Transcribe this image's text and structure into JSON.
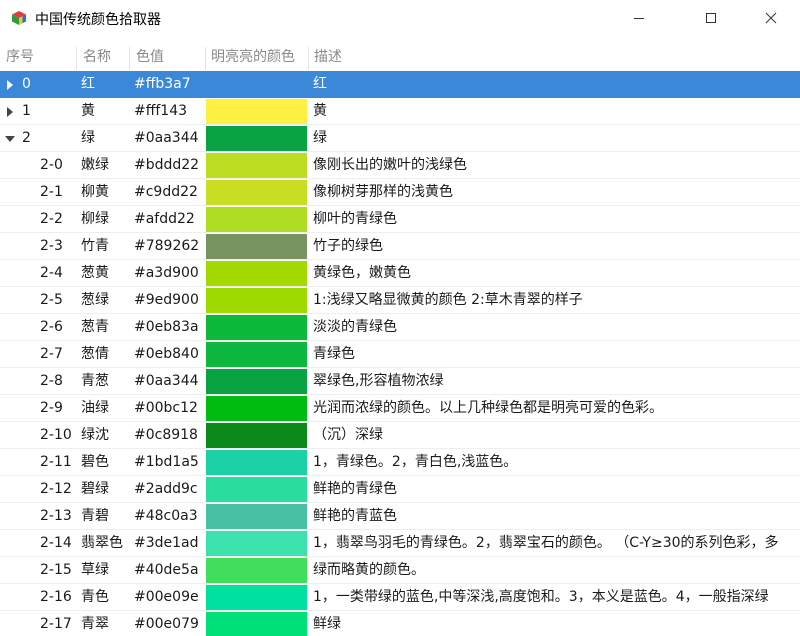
{
  "window": {
    "title": "中国传统颜色拾取器",
    "controls": [
      "minimize",
      "maximize",
      "close"
    ]
  },
  "columns": [
    "序号",
    "名称",
    "色值",
    "明亮亮的颜色",
    "描述"
  ],
  "rows": [
    {
      "id": "0",
      "name": "红",
      "hex": "#ffb3a7",
      "desc": "红",
      "level": 0,
      "toggle": "collapsed",
      "selected": true
    },
    {
      "id": "1",
      "name": "黄",
      "hex": "#fff143",
      "desc": "黄",
      "level": 0,
      "toggle": "collapsed"
    },
    {
      "id": "2",
      "name": "绿",
      "hex": "#0aa344",
      "desc": "绿",
      "level": 0,
      "toggle": "expanded"
    },
    {
      "id": "2-0",
      "name": "嫩绿",
      "hex": "#bddd22",
      "desc": "像刚长出的嫩叶的浅绿色",
      "level": 1
    },
    {
      "id": "2-1",
      "name": "柳黄",
      "hex": "#c9dd22",
      "desc": "像柳树芽那样的浅黄色",
      "level": 1
    },
    {
      "id": "2-2",
      "name": "柳绿",
      "hex": "#afdd22",
      "desc": "柳叶的青绿色",
      "level": 1
    },
    {
      "id": "2-3",
      "name": "竹青",
      "hex": "#789262",
      "desc": "竹子的绿色",
      "level": 1
    },
    {
      "id": "2-4",
      "name": "葱黄",
      "hex": "#a3d900",
      "desc": "黄绿色，嫩黄色",
      "level": 1
    },
    {
      "id": "2-5",
      "name": "葱绿",
      "hex": "#9ed900",
      "desc": "1:浅绿又略显微黄的颜色 2:草木青翠的样子",
      "level": 1
    },
    {
      "id": "2-6",
      "name": "葱青",
      "hex": "#0eb83a",
      "desc": "淡淡的青绿色",
      "level": 1
    },
    {
      "id": "2-7",
      "name": "葱倩",
      "hex": "#0eb840",
      "desc": "青绿色",
      "level": 1
    },
    {
      "id": "2-8",
      "name": "青葱",
      "hex": "#0aa344",
      "desc": "翠绿色,形容植物浓绿",
      "level": 1
    },
    {
      "id": "2-9",
      "name": "油绿",
      "hex": "#00bc12",
      "desc": "光润而浓绿的颜色。以上几种绿色都是明亮可爱的色彩。",
      "level": 1
    },
    {
      "id": "2-10",
      "name": "绿沈",
      "hex": "#0c8918",
      "desc": "（沉）深绿",
      "level": 1
    },
    {
      "id": "2-11",
      "name": "碧色",
      "hex": "#1bd1a5",
      "desc": "1，青绿色。2，青白色,浅蓝色。",
      "level": 1
    },
    {
      "id": "2-12",
      "name": "碧绿",
      "hex": "#2add9c",
      "desc": "鲜艳的青绿色",
      "level": 1
    },
    {
      "id": "2-13",
      "name": "青碧",
      "hex": "#48c0a3",
      "desc": "鲜艳的青蓝色",
      "level": 1
    },
    {
      "id": "2-14",
      "name": "翡翠色",
      "hex": "#3de1ad",
      "desc": "1，翡翠鸟羽毛的青绿色。2，翡翠宝石的颜色。 （C-Y≥30的系列色彩，多",
      "level": 1
    },
    {
      "id": "2-15",
      "name": "草绿",
      "hex": "#40de5a",
      "desc": "绿而略黄的颜色。",
      "level": 1
    },
    {
      "id": "2-16",
      "name": "青色",
      "hex": "#00e09e",
      "desc": "1，一类带绿的蓝色,中等深浅,高度饱和。3，本义是蓝色。4，一般指深绿",
      "level": 1
    },
    {
      "id": "2-17",
      "name": "青翠",
      "hex": "#00e079",
      "desc": "鲜绿",
      "level": 1
    }
  ],
  "colors": {
    "selection": "#3b88d9",
    "header_text": "#8a8a8a",
    "toggle_arrow": "#444444"
  }
}
